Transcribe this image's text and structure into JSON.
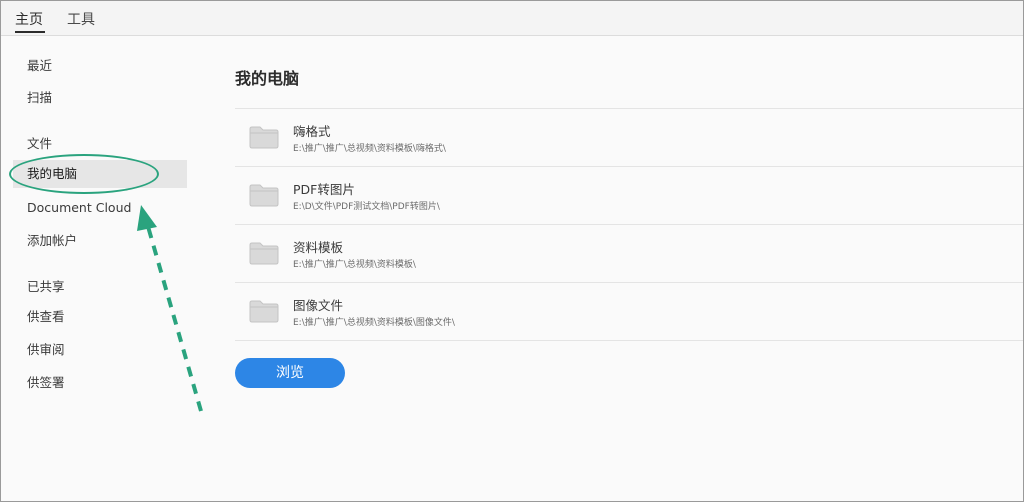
{
  "tabs": {
    "home": "主页",
    "tools": "工具"
  },
  "sidebar": {
    "recent": "最近",
    "scan": "扫描",
    "files_heading": "文件",
    "my_computer": "我的电脑",
    "document_cloud": "Document Cloud",
    "add_account": "添加帐户",
    "shared_heading": "已共享",
    "for_review": "供查看",
    "for_approval": "供审阅",
    "for_signature": "供签署"
  },
  "main": {
    "title": "我的电脑",
    "folders": [
      {
        "name": "嗨格式",
        "path": "E:\\推广\\推广\\总视频\\资料模板\\嗨格式\\"
      },
      {
        "name": "PDF转图片",
        "path": "E:\\D\\文件\\PDF测试文档\\PDF转图片\\"
      },
      {
        "name": "资料模板",
        "path": "E:\\推广\\推广\\总视频\\资料模板\\"
      },
      {
        "name": "图像文件",
        "path": "E:\\推广\\推广\\总视频\\资料模板\\图像文件\\"
      }
    ],
    "browse_label": "浏览"
  },
  "colors": {
    "accent": "#2d86e6",
    "annotation": "#2aa37e",
    "selected_bg": "#e6e6e6"
  },
  "icons": {
    "folder": "folder-icon"
  }
}
